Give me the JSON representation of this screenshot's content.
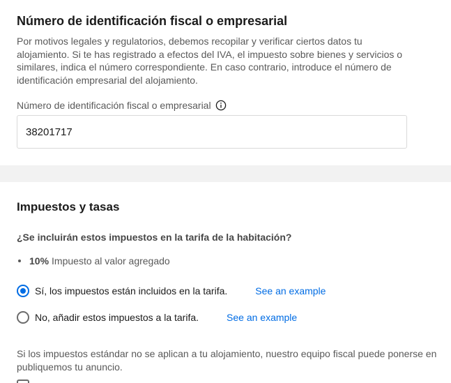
{
  "tax_id_section": {
    "title": "Número de identificación fiscal o empresarial",
    "description": "Por motivos legales y regulatorios, debemos recopilar y verificar ciertos datos tu alojamiento. Si te has registrado a efectos del IVA, el impuesto sobre bienes y servicios o similares, indica el número correspondiente. En caso contrario, introduce el número de identificación empresarial del alojamiento.",
    "field_label": "Número de identificación fiscal o empresarial",
    "field_value": "38201717",
    "info_icon": "info-icon"
  },
  "taxes_section": {
    "title": "Impuestos y tasas",
    "question": "¿Se incluirán estos impuestos en la tarifa de la habitación?",
    "tax_items": [
      {
        "percent": "10%",
        "label": "Impuesto al valor agregado"
      }
    ],
    "options": [
      {
        "label": "Sí, los impuestos están incluidos en la tarifa.",
        "selected": true,
        "link": "See an example"
      },
      {
        "label": "No, añadir estos impuestos a la tarifa.",
        "selected": false,
        "link": "See an example"
      }
    ],
    "footer_line1": "Si los impuestos estándar no se aplican a tu alojamiento, nuestro equipo fiscal puede ponerse en",
    "footer_line2": "publiquemos tu anuncio."
  },
  "colors": {
    "accent": "#006ce4",
    "divider_band": "#f2f2f2",
    "muted_text": "#595959"
  }
}
